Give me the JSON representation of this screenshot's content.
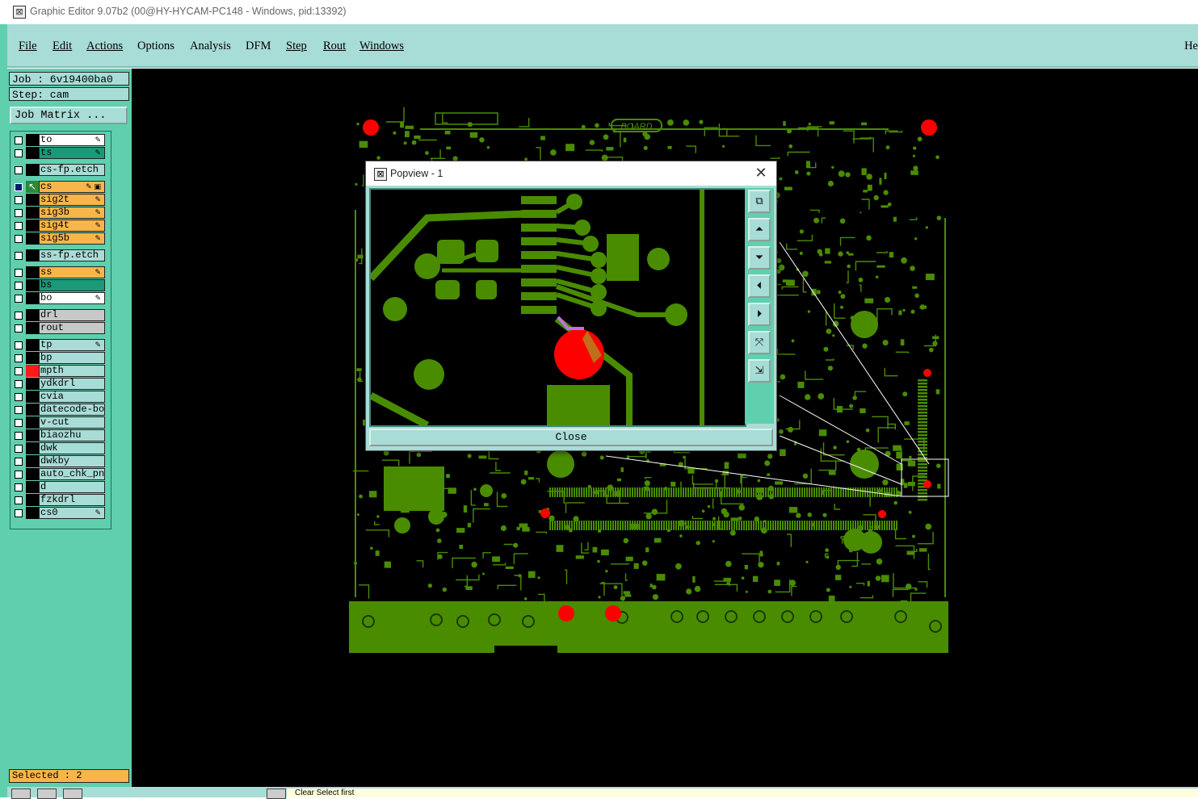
{
  "window": {
    "title": "Graphic Editor 9.07b2 (00@HY-HYCAM-PC148 - Windows, pid:13392)",
    "icon": "app-icon"
  },
  "menu": {
    "items": [
      "File",
      "Edit",
      "Actions",
      "Options",
      "Analysis",
      "DFM",
      "Step",
      "Rout",
      "Windows"
    ],
    "help": "He"
  },
  "job": {
    "label": "Job : 6v19400ba0",
    "step": "Step: cam",
    "matrix_button": "Job Matrix ..."
  },
  "layers": [
    {
      "name": "to",
      "color": "#ffffff",
      "marker": "✎",
      "checked": false
    },
    {
      "name": "ts",
      "color": "#1a9a78",
      "marker": "✎",
      "checked": false
    },
    {
      "name": "cs-fp.etch",
      "color": "#a8dcd6",
      "marker": "",
      "checked": false
    },
    {
      "name": "cs",
      "color": "#f7b54a",
      "marker": "✎ ▣",
      "checked": true,
      "work": true
    },
    {
      "name": "sig2t",
      "color": "#f7b54a",
      "marker": "✎",
      "checked": false
    },
    {
      "name": "sig3b",
      "color": "#f7b54a",
      "marker": "✎",
      "checked": false
    },
    {
      "name": "sig4t",
      "color": "#f7b54a",
      "marker": "✎",
      "checked": false
    },
    {
      "name": "sig5b",
      "color": "#f7b54a",
      "marker": "✎",
      "checked": false
    },
    {
      "name": "ss-fp.etch",
      "color": "#a8dcd6",
      "marker": "",
      "checked": false
    },
    {
      "name": "ss",
      "color": "#f7b54a",
      "marker": "✎",
      "checked": false
    },
    {
      "name": "bs",
      "color": "#1a9a78",
      "marker": "",
      "checked": false
    },
    {
      "name": "bo",
      "color": "#ffffff",
      "marker": "✎",
      "checked": false
    },
    {
      "name": "drl",
      "color": "#c8c8c8",
      "marker": "",
      "checked": false
    },
    {
      "name": "rout",
      "color": "#c8c8c8",
      "marker": "",
      "checked": false
    },
    {
      "name": "tp",
      "color": "#a8dcd6",
      "marker": "✎",
      "checked": false
    },
    {
      "name": "bp",
      "color": "#a8dcd6",
      "marker": "",
      "checked": false
    },
    {
      "name": "mpth",
      "color": "#a8dcd6",
      "marker": "",
      "checked": false,
      "affected": true
    },
    {
      "name": "ydkdrl",
      "color": "#a8dcd6",
      "marker": "",
      "checked": false
    },
    {
      "name": "cvia",
      "color": "#a8dcd6",
      "marker": "",
      "checked": false
    },
    {
      "name": "datecode-bo",
      "color": "#a8dcd6",
      "marker": "",
      "checked": false
    },
    {
      "name": "v-cut",
      "color": "#a8dcd6",
      "marker": "",
      "checked": false
    },
    {
      "name": "biaozhu",
      "color": "#a8dcd6",
      "marker": "",
      "checked": false
    },
    {
      "name": "dwk",
      "color": "#a8dcd6",
      "marker": "",
      "checked": false
    },
    {
      "name": "dwkby",
      "color": "#a8dcd6",
      "marker": "",
      "checked": false
    },
    {
      "name": "auto_chk_pn",
      "color": "#a8dcd6",
      "marker": "",
      "checked": false
    },
    {
      "name": "d",
      "color": "#a8dcd6",
      "marker": "",
      "checked": false
    },
    {
      "name": "fzkdrl",
      "color": "#a8dcd6",
      "marker": "",
      "checked": false
    },
    {
      "name": "cs0",
      "color": "#a8dcd6",
      "marker": "✎",
      "checked": false
    }
  ],
  "selected": "Selected : 2",
  "board": {
    "label": "BOARD",
    "copper_color": "#4a8c00",
    "pad_color": "#ff0000",
    "bg": "#000000"
  },
  "popview": {
    "title": "Popview - 1",
    "close": "Close",
    "tool_icons": [
      "zoom-fit-icon",
      "pan-up-icon",
      "pan-down-icon",
      "pan-left-icon",
      "pan-right-icon",
      "zoom-in-icon",
      "zoom-out-icon"
    ]
  },
  "status": {
    "text": "Clear Select first"
  }
}
